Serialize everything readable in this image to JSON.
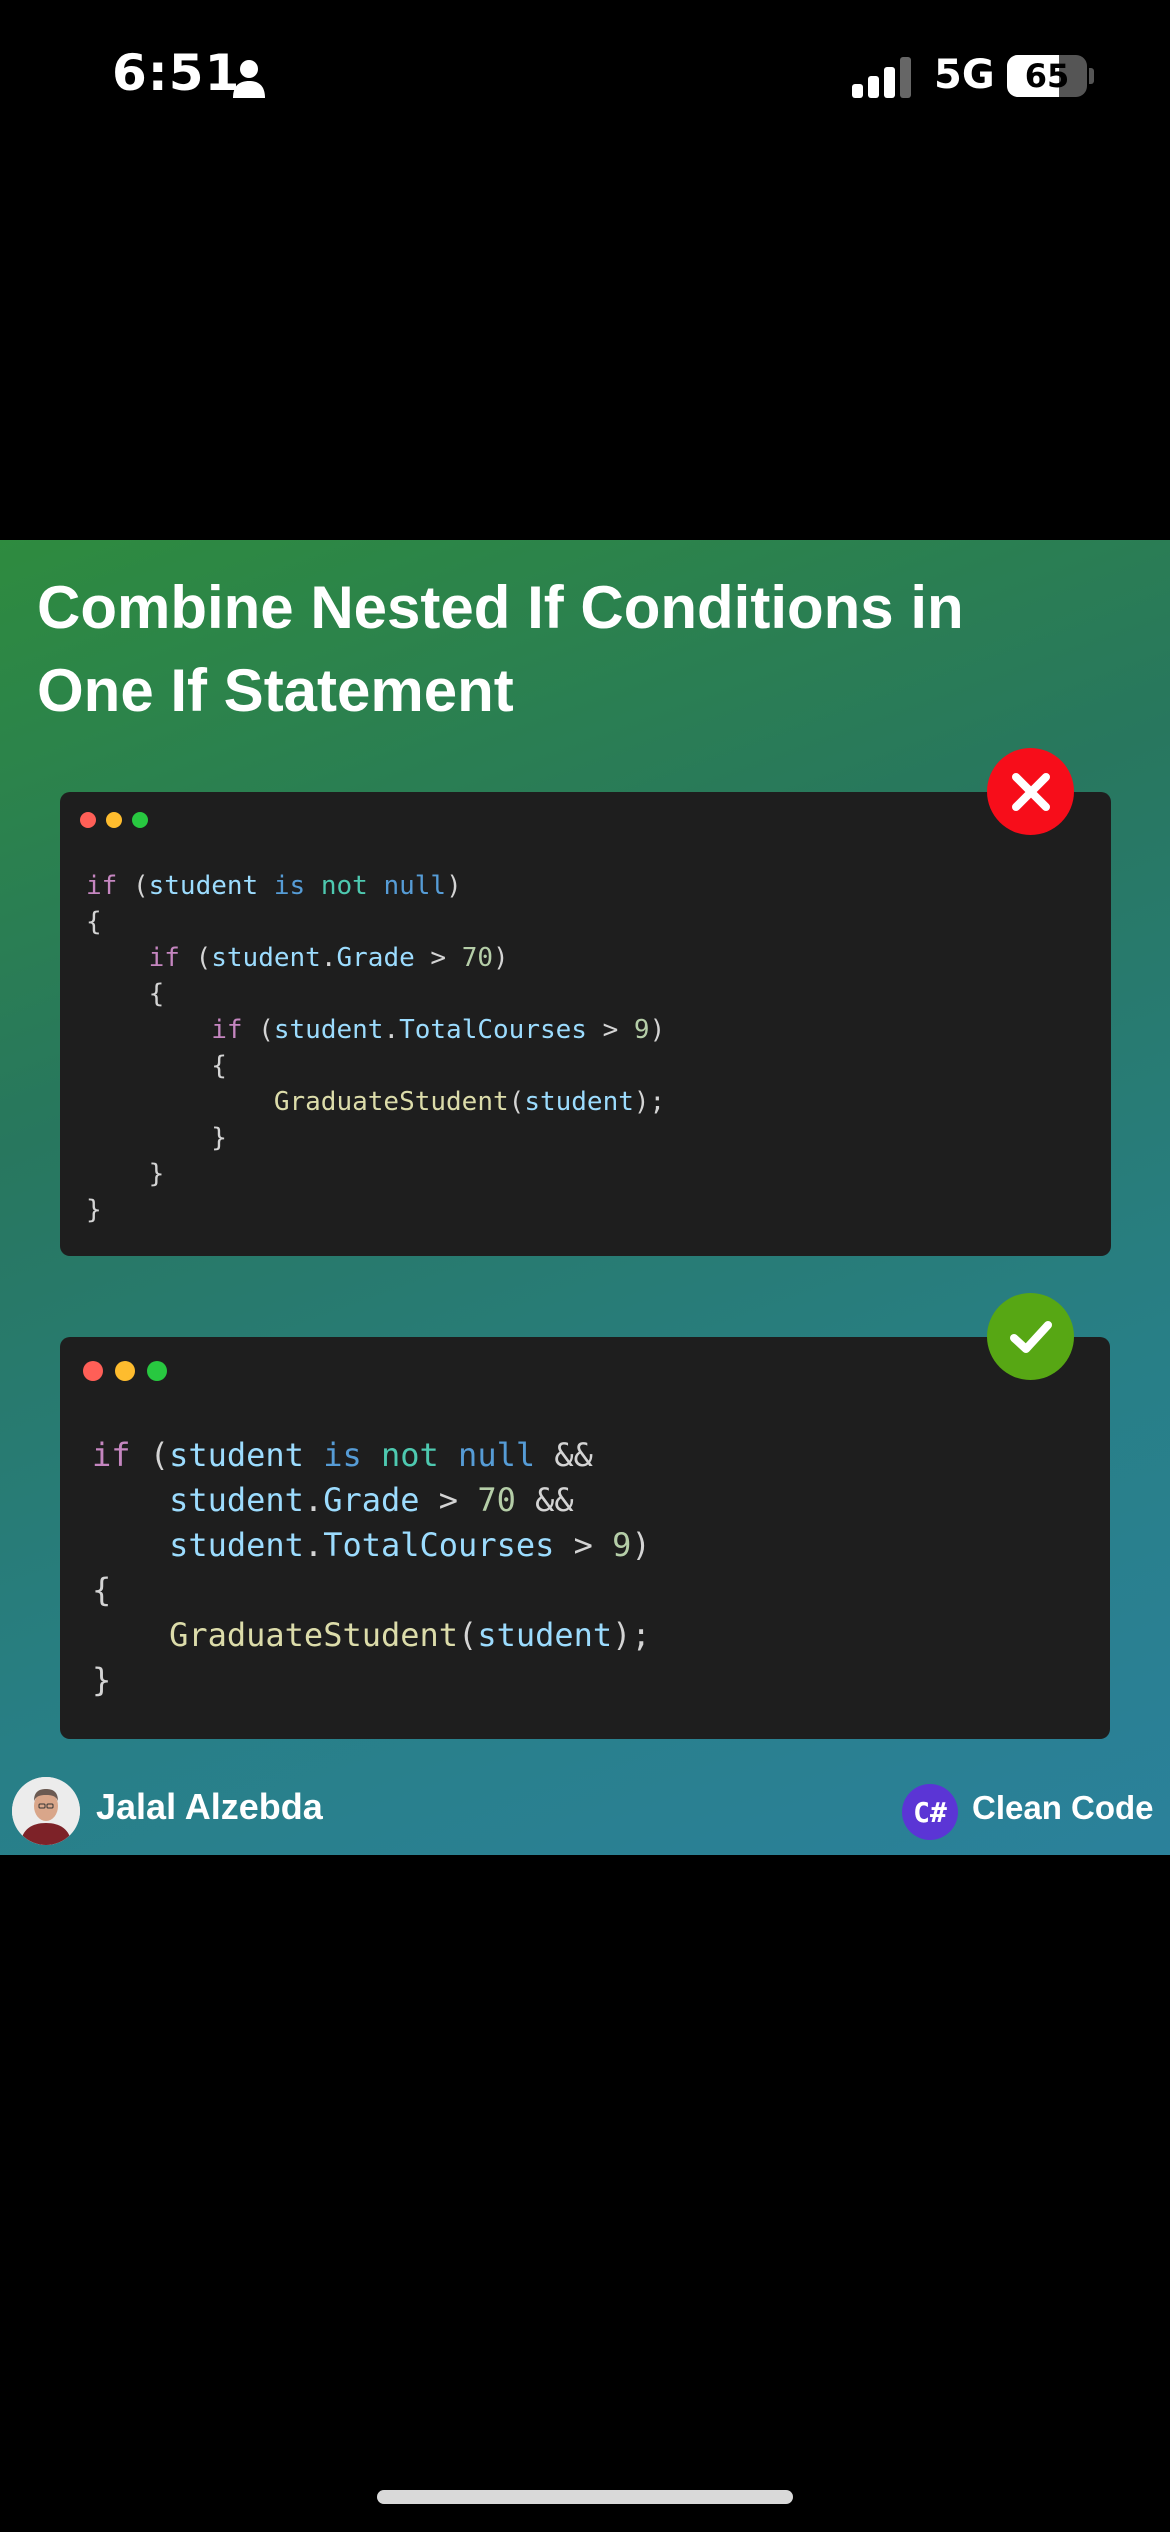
{
  "status_bar": {
    "time": "6:51",
    "network": "5G",
    "battery_percent": "65",
    "battery_level": 0.65,
    "icons": [
      "person-icon",
      "signal-icon",
      "battery-icon"
    ]
  },
  "post": {
    "title_line1": "Combine Nested If Conditions in",
    "title_line2": "One If Statement",
    "bad_badge_icon": "x-mark-icon",
    "good_badge_icon": "check-mark-icon",
    "colors": {
      "bad_badge": "#f70d1a",
      "good_badge": "#57a714",
      "card_bg": "#1e1e1e",
      "csharp_logo": "#5b35d5"
    },
    "bad_code": [
      [
        [
          "if",
          "ctrl"
        ],
        [
          " (",
          "p"
        ],
        [
          "student",
          "var"
        ],
        [
          " ",
          "p"
        ],
        [
          "is",
          "kw"
        ],
        [
          " ",
          "p"
        ],
        [
          "not",
          "not"
        ],
        [
          " ",
          "p"
        ],
        [
          "null",
          "kw"
        ],
        [
          ")",
          "p"
        ]
      ],
      [
        [
          "{",
          "p"
        ]
      ],
      [
        [
          "    ",
          "p"
        ],
        [
          "if",
          "ctrl"
        ],
        [
          " (",
          "p"
        ],
        [
          "student",
          "var"
        ],
        [
          ".",
          "p"
        ],
        [
          "Grade",
          "var"
        ],
        [
          " > ",
          "p"
        ],
        [
          "70",
          "num"
        ],
        [
          ")",
          "p"
        ]
      ],
      [
        [
          "    {",
          "p"
        ]
      ],
      [
        [
          "        ",
          "p"
        ],
        [
          "if",
          "ctrl"
        ],
        [
          " (",
          "p"
        ],
        [
          "student",
          "var"
        ],
        [
          ".",
          "p"
        ],
        [
          "TotalCourses",
          "var"
        ],
        [
          " > ",
          "p"
        ],
        [
          "9",
          "num"
        ],
        [
          ")",
          "p"
        ]
      ],
      [
        [
          "        {",
          "p"
        ]
      ],
      [
        [
          "            ",
          "p"
        ],
        [
          "GraduateStudent",
          "fn"
        ],
        [
          "(",
          "p"
        ],
        [
          "student",
          "var"
        ],
        [
          ");",
          "p"
        ]
      ],
      [
        [
          "        }",
          "p"
        ]
      ],
      [
        [
          "    }",
          "p"
        ]
      ],
      [
        [
          "}",
          "p"
        ]
      ]
    ],
    "good_code": [
      [
        [
          "if",
          "ctrl"
        ],
        [
          " (",
          "p"
        ],
        [
          "student",
          "var"
        ],
        [
          " ",
          "p"
        ],
        [
          "is",
          "kw"
        ],
        [
          " ",
          "p"
        ],
        [
          "not",
          "not"
        ],
        [
          " ",
          "p"
        ],
        [
          "null",
          "kw"
        ],
        [
          " &&",
          "p"
        ]
      ],
      [
        [
          "    ",
          "p"
        ],
        [
          "student",
          "var"
        ],
        [
          ".",
          "p"
        ],
        [
          "Grade",
          "var"
        ],
        [
          " > ",
          "p"
        ],
        [
          "70",
          "num"
        ],
        [
          " &&",
          "p"
        ]
      ],
      [
        [
          "    ",
          "p"
        ],
        [
          "student",
          "var"
        ],
        [
          ".",
          "p"
        ],
        [
          "TotalCourses",
          "var"
        ],
        [
          " > ",
          "p"
        ],
        [
          "9",
          "num"
        ],
        [
          ")",
          "p"
        ]
      ],
      [
        [
          "{",
          "p"
        ]
      ],
      [
        [
          "    ",
          "p"
        ],
        [
          "GraduateStudent",
          "fn"
        ],
        [
          "(",
          "p"
        ],
        [
          "student",
          "var"
        ],
        [
          ");",
          "p"
        ]
      ],
      [
        [
          "}",
          "p"
        ]
      ]
    ],
    "author_name": "Jalal Alzebda",
    "author_avatar_icon": "avatar-photo",
    "brand_logo_text": "C#",
    "brand_label": "Clean Code"
  }
}
